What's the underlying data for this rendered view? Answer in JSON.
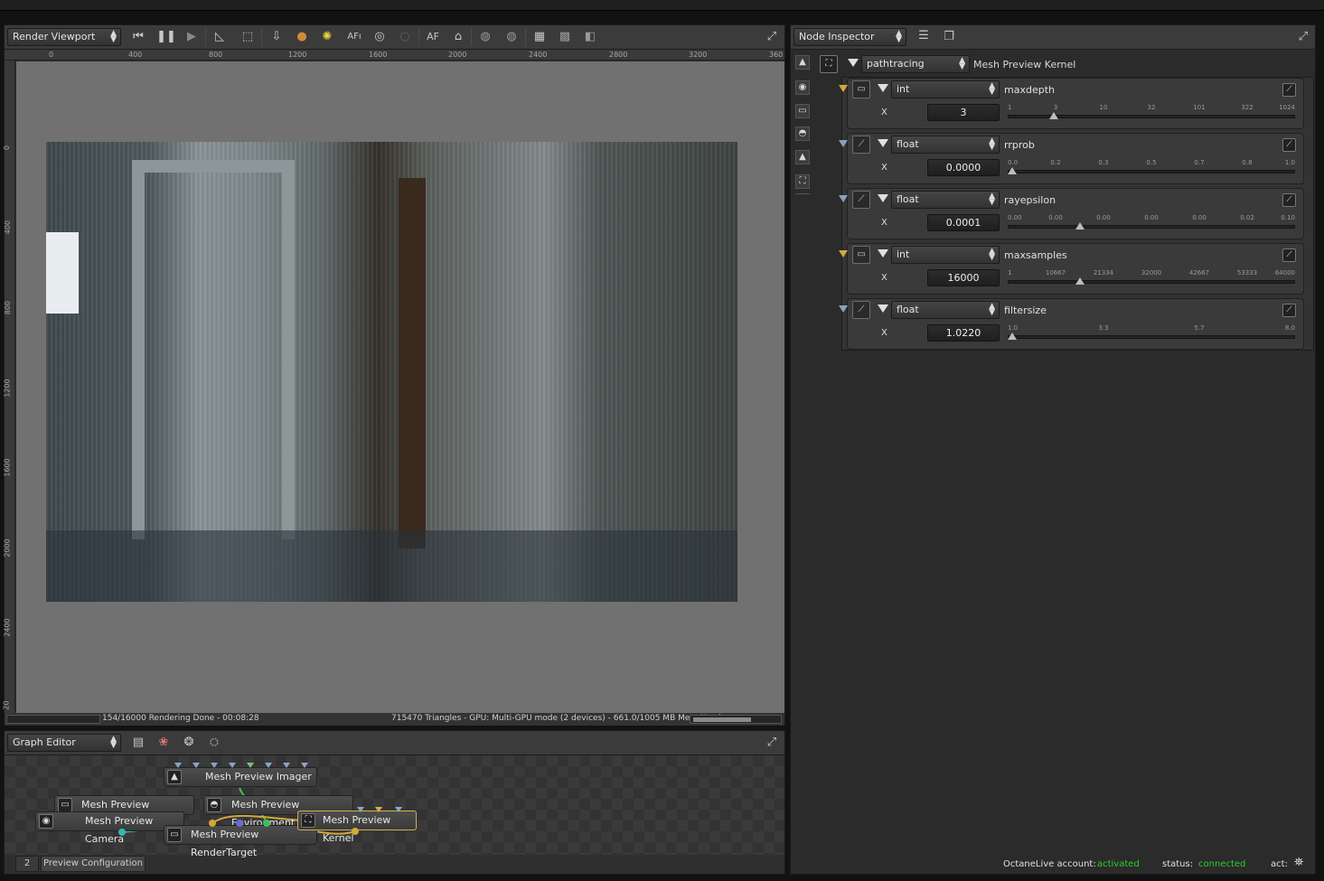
{
  "render_viewport": {
    "mode_combo": "Render Viewport",
    "toolbar_icons": [
      "restart-icon",
      "pause-icon",
      "play-icon",
      "ruler-tool-icon",
      "region-icon",
      "export-icon",
      "material-picker-icon",
      "light-icon",
      "autofocus-icon",
      "focus-picker-icon",
      "white-balance-icon",
      "af-icon",
      "clay-icon",
      "world-icon",
      "world-alt-icon",
      "subsample-icon",
      "checker-icon",
      "alpha-icon"
    ],
    "af_label": "AF",
    "ruler_top": [
      "0",
      "400",
      "800",
      "1200",
      "1600",
      "2000",
      "2400",
      "2800",
      "3200",
      "360"
    ],
    "ruler_left": [
      "0",
      "400",
      "800",
      "1200",
      "1600",
      "2000",
      "2400",
      "20"
    ],
    "status_left": "154/16000 Rendering Done - 00:08:28",
    "status_right": "715470 Triangles - GPU: Multi-GPU mode (2 devices) - 661.0/1005 MB Mem Used",
    "progress": 1.0
  },
  "graph_editor": {
    "mode_combo": "Graph Editor",
    "nodes": {
      "imager": "Mesh Preview Imager",
      "resolution": "Mesh Preview Resolution",
      "environment": "Mesh Preview Environment",
      "camera": "Mesh Preview Camera",
      "kernel": "Mesh Preview Kernel",
      "rendertarget": "Mesh Preview RenderTarget"
    },
    "tabs": [
      "2",
      "Preview Configuration"
    ]
  },
  "node_inspector": {
    "mode_combo": "Node Inspector",
    "kernel_type": "pathtracing",
    "kernel_name": "Mesh Preview Kernel",
    "params": [
      {
        "type": "int",
        "name": "maxdepth",
        "axis": "X",
        "value": "3",
        "ticks": [
          "1",
          "3",
          "10",
          "32",
          "101",
          "322",
          "1024"
        ],
        "fraction": 0.16,
        "level": "y"
      },
      {
        "type": "float",
        "name": "rrprob",
        "axis": "X",
        "value": "0.0000",
        "ticks": [
          "0.0",
          "0.2",
          "0.3",
          "0.5",
          "0.7",
          "0.8",
          "1.0"
        ],
        "fraction": 0.0,
        "level": "b"
      },
      {
        "type": "float",
        "name": "rayepsilon",
        "axis": "X",
        "value": "0.0001",
        "ticks": [
          "0.00",
          "0.00",
          "0.00",
          "0.00",
          "0.00",
          "0.02",
          "0.10"
        ],
        "fraction": 0.25,
        "level": "b"
      },
      {
        "type": "int",
        "name": "maxsamples",
        "axis": "X",
        "value": "16000",
        "ticks": [
          "1",
          "10667",
          "21334",
          "32000",
          "42667",
          "53333",
          "64000"
        ],
        "fraction": 0.25,
        "level": "y"
      },
      {
        "type": "float",
        "name": "filtersize",
        "axis": "X",
        "value": "1.0220",
        "ticks": [
          "1.0",
          "3.3",
          "5.7",
          "8.0"
        ],
        "fraction": 0.0,
        "level": "b"
      }
    ]
  },
  "footer": {
    "account_label": "OctaneLive account:",
    "account_value": "activated",
    "status_label": "status:",
    "status_value": "connected",
    "act_label": "act:"
  },
  "colors": {
    "accent_green": "#28d028",
    "selection_yellow": "#d4b04a"
  }
}
